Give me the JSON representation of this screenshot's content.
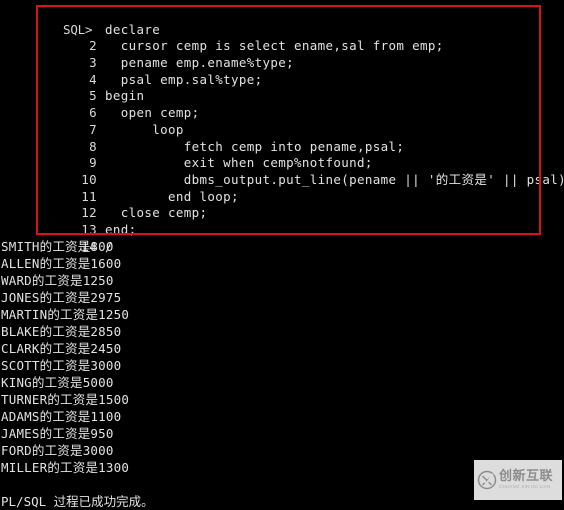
{
  "terminal": {
    "prompt": "SQL>",
    "background_color": "#000000",
    "text_color": "#e2e2e2",
    "highlight_box_color": "#d81217"
  },
  "code_block": {
    "lines": [
      {
        "gutter": "SQL>",
        "text": "declare"
      },
      {
        "gutter": "2",
        "text": "  cursor cemp is select ename,sal from emp;"
      },
      {
        "gutter": "3",
        "text": "  pename emp.ename%type;"
      },
      {
        "gutter": "4",
        "text": "  psal emp.sal%type;"
      },
      {
        "gutter": "5",
        "text": "begin"
      },
      {
        "gutter": "6",
        "text": "  open cemp;"
      },
      {
        "gutter": "7",
        "text": "      loop"
      },
      {
        "gutter": "8",
        "text": "          fetch cemp into pename,psal;"
      },
      {
        "gutter": "9",
        "text": "          exit when cemp%notfound;"
      },
      {
        "gutter": "10",
        "text": "          dbms_output.put_line(pename || '的工资是' || psal);"
      },
      {
        "gutter": "11",
        "text": "        end loop;"
      },
      {
        "gutter": "12",
        "text": "  close cemp;"
      },
      {
        "gutter": "13",
        "text": "end;"
      },
      {
        "gutter": "14",
        "text": "/"
      }
    ]
  },
  "output": {
    "lines": [
      "SMITH的工资是800",
      "ALLEN的工资是1600",
      "WARD的工资是1250",
      "JONES的工资是2975",
      "MARTIN的工资是1250",
      "BLAKE的工资是2850",
      "CLARK的工资是2450",
      "SCOTT的工资是3000",
      "KING的工资是5000",
      "TURNER的工资是1500",
      "ADAMS的工资是1100",
      "JAMES的工资是950",
      "FORD的工资是3000",
      "MILLER的工资是1300"
    ],
    "final_message": "PL/SQL 过程已成功完成。"
  },
  "watermark": {
    "icon": "circle-x-logo-icon",
    "chinese_text": "创新互联",
    "latin_text": "CHUANG XIN HU LIAN"
  }
}
